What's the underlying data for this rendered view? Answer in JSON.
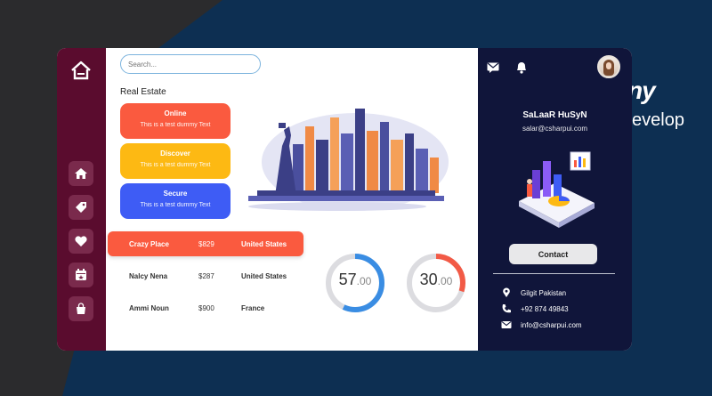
{
  "background": {
    "text_1": "ny",
    "text_2": "evelop"
  },
  "search": {
    "placeholder": "Search..."
  },
  "section_title": "Real Estate",
  "cards": [
    {
      "title": "Online",
      "subtitle": "This is a test dummy Text",
      "color": "#fa5a3f"
    },
    {
      "title": "Discover",
      "subtitle": "This is a test dummy Text",
      "color": "#fdb913"
    },
    {
      "title": "Secure",
      "subtitle": "This is a test dummy Text",
      "color": "#3e5cf5"
    }
  ],
  "table": [
    {
      "name": "Crazy Place",
      "price": "$829",
      "country": "United States"
    },
    {
      "name": "Nalcy Nena",
      "price": "$287",
      "country": "United States"
    },
    {
      "name": "Ammi Noun",
      "price": "$900",
      "country": "France"
    }
  ],
  "gauges": [
    {
      "value": "57",
      "decimals": ".00",
      "percent": 57,
      "color": "#3a8de3"
    },
    {
      "value": "30",
      "decimals": ".00",
      "percent": 30,
      "color": "#f25a46"
    }
  ],
  "sidebar": {
    "icons": [
      "home-icon",
      "tag-icon",
      "heart-icon",
      "calendar-star-icon",
      "shopping-bag-icon"
    ]
  },
  "profile": {
    "name": "SaLaaR HuSyN",
    "email": "salar@csharpui.com",
    "contact_label": "Contact"
  },
  "info": [
    {
      "icon": "location-pin-icon",
      "text": "Gilgit Pakistan"
    },
    {
      "icon": "phone-icon",
      "text": "+92 874 49843"
    },
    {
      "icon": "mail-icon",
      "text": "info@csharpui.com"
    }
  ]
}
